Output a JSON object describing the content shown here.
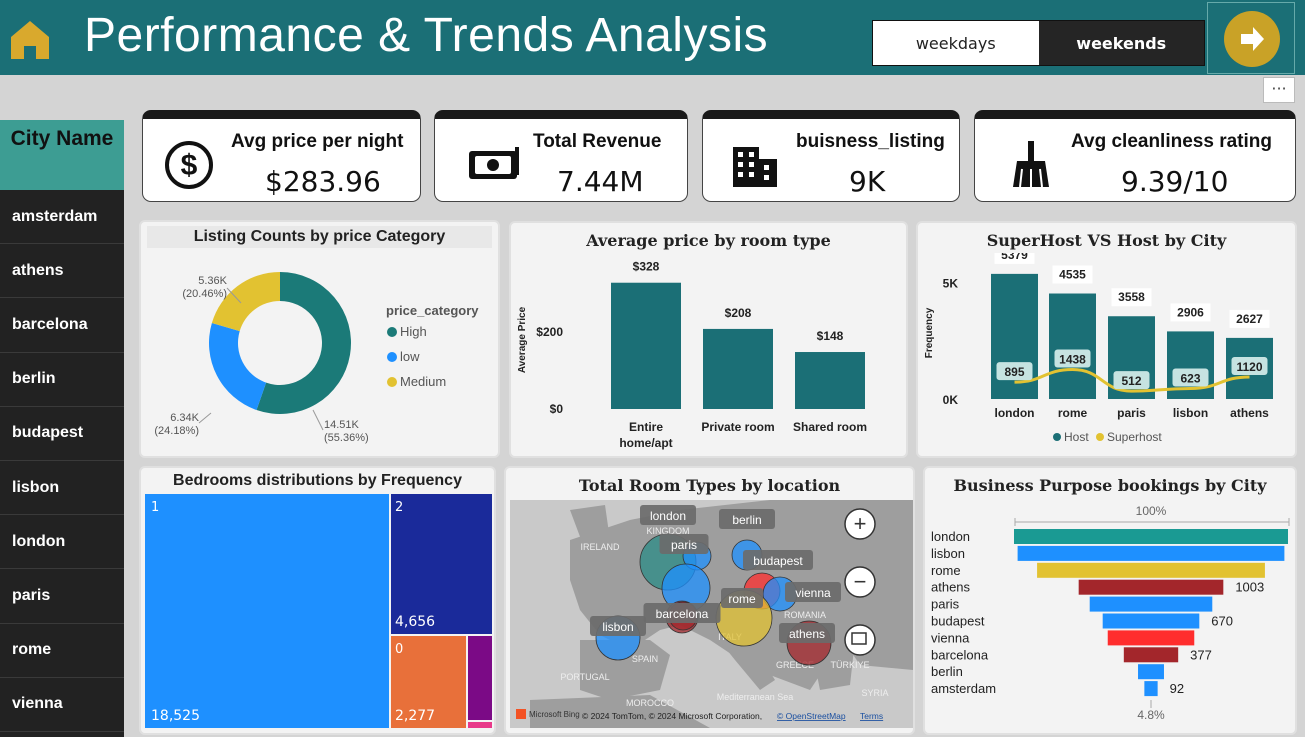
{
  "header": {
    "title": "Performance & Trends Analysis",
    "toggle": {
      "weekdays": "weekdays",
      "weekends": "weekends"
    },
    "more_label": "···"
  },
  "sidebar": {
    "header": "City Name",
    "items": [
      "amsterdam",
      "athens",
      "barcelona",
      "berlin",
      "budapest",
      "lisbon",
      "london",
      "paris",
      "rome",
      "vienna"
    ]
  },
  "kpis": [
    {
      "label": "Avg price per night",
      "value": "$283.96",
      "icon": "dollar-icon"
    },
    {
      "label": "Total Revenue",
      "value": "7.44M",
      "icon": "money-icon"
    },
    {
      "label": "buisness_listing",
      "value": "9K",
      "icon": "building-icon"
    },
    {
      "label": "Avg cleanliness rating",
      "value": "9.39/10",
      "icon": "broom-icon"
    }
  ],
  "colors": {
    "teal": "#1b6f76",
    "blue": "#1e90ff",
    "gold": "#e2c231",
    "header": "#1b6f76"
  },
  "chart_data": [
    {
      "type": "pie",
      "title": "Listing Counts by price Category",
      "legend_title": "price_category",
      "slices": [
        {
          "name": "High",
          "value": 14510,
          "label": "14.51K",
          "pct": "(55.36%)",
          "color": "#1b7a78"
        },
        {
          "name": "low",
          "value": 6340,
          "label": "6.34K",
          "pct": "(24.18%)",
          "color": "#1e90ff"
        },
        {
          "name": "Medium",
          "value": 5360,
          "label": "5.36K",
          "pct": "(20.46%)",
          "color": "#e2c231"
        }
      ]
    },
    {
      "type": "bar",
      "title": "Average price by room type",
      "ylabel": "Average Price",
      "yticks": [
        "$0",
        "$200"
      ],
      "categories": [
        "Entire home/apt",
        "Private room",
        "Shared room"
      ],
      "values": [
        328,
        208,
        148
      ],
      "labels": [
        "$328",
        "$208",
        "$148"
      ],
      "ylim": [
        0,
        400
      ]
    },
    {
      "type": "bar",
      "title": "SuperHost VS Host by City",
      "ylabel": "Frequency",
      "yticks": [
        "0K",
        "5K"
      ],
      "categories": [
        "london",
        "rome",
        "paris",
        "lisbon",
        "athens"
      ],
      "series": [
        {
          "name": "Host",
          "values": [
            5379,
            4535,
            3558,
            2906,
            2627
          ],
          "color": "#1b6f76"
        },
        {
          "name": "Superhost",
          "values": [
            895,
            1438,
            512,
            623,
            1120
          ],
          "color": "#e2c231"
        }
      ],
      "ylim": [
        0,
        6500
      ]
    },
    {
      "type": "heatmap",
      "title": "Bedrooms distributions by Frequency",
      "tiles": [
        {
          "name": "1",
          "value": "18,525",
          "color": "#1e90ff"
        },
        {
          "name": "2",
          "value": "4,656",
          "color": "#1a2a9a"
        },
        {
          "name": "0",
          "value": "2,277",
          "color": "#e8703a"
        }
      ]
    },
    {
      "type": "scatter",
      "title": "Total Room Types by location",
      "cities": [
        "london",
        "berlin",
        "paris",
        "budapest",
        "rome",
        "vienna",
        "barcelona",
        "lisbon",
        "athens"
      ],
      "map_labels": [
        "IRELAND",
        "SPAIN",
        "PORTUGAL",
        "ITALY",
        "TÜRKIYE",
        "SYRIA",
        "GREECE",
        "ROMANIA",
        "MOROCCO",
        "Mediterranean Sea",
        "KINGDOM"
      ],
      "attribution": "© 2024 TomTom, © 2024 Microsoft Corporation,",
      "osm": "© OpenStreetMap",
      "terms": "Terms",
      "brand": "Microsoft Bing"
    },
    {
      "type": "bar",
      "title": "Business Purpose bookings by City",
      "top_label": "100%",
      "bottom_label": "4.8%",
      "categories": [
        "london",
        "lisbon",
        "rome",
        "athens",
        "paris",
        "budapest",
        "vienna",
        "barcelona",
        "berlin",
        "amsterdam"
      ],
      "values": [
        1900,
        1850,
        1580,
        1003,
        850,
        670,
        600,
        377,
        180,
        92
      ],
      "labels": [
        "",
        "",
        "",
        "1003",
        "",
        "670",
        "",
        "377",
        "",
        "92"
      ]
    }
  ]
}
